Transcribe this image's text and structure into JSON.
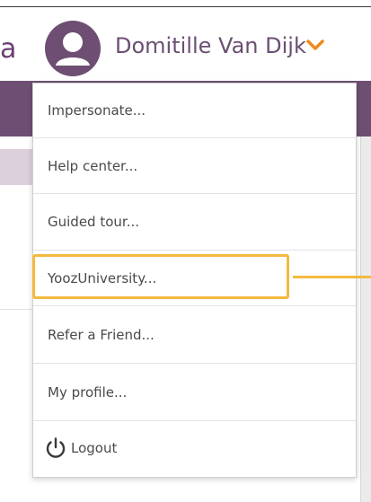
{
  "header": {
    "partial_text": "a",
    "user_name": "Domitille Van Dijk",
    "avatar_icon": "user-avatar-icon",
    "dropdown_icon": "chevron-down-icon"
  },
  "menu": {
    "items": [
      {
        "label": "Impersonate..."
      },
      {
        "label": "Help center..."
      },
      {
        "label": "Guided tour..."
      },
      {
        "label": "YoozUniversity..."
      },
      {
        "label": "Refer a Friend..."
      },
      {
        "label": "My profile..."
      },
      {
        "label": "Logout",
        "icon": "power-icon"
      }
    ]
  },
  "colors": {
    "brand_purple": "#6e4f73",
    "accent_orange": "#f08a1c",
    "highlight_yellow": "#f4b940"
  }
}
